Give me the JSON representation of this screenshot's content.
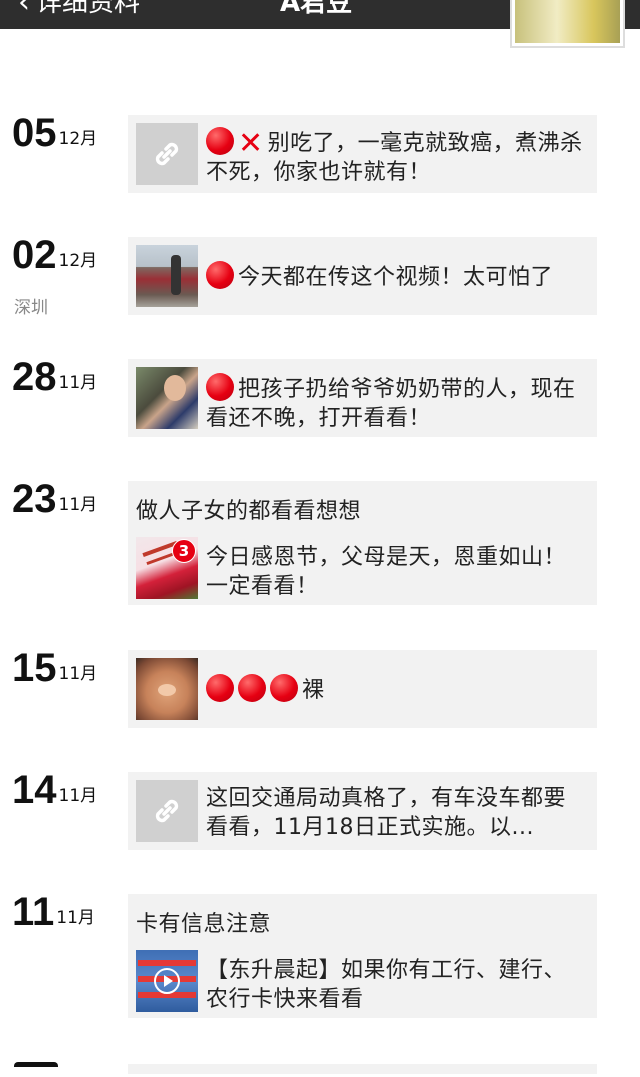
{
  "nav": {
    "back_label": "详细资料",
    "title": "A君豆"
  },
  "entries": [
    {
      "day": "05",
      "month": "12月",
      "items": [
        {
          "text": "别吃了，一毫克就致癌，煮沸杀不死，你家也许就有！",
          "thumb": "link-icon",
          "emoji": [
            "red-circle",
            "red-x"
          ]
        }
      ]
    },
    {
      "day": "02",
      "month": "12月",
      "location": "深圳",
      "items": [
        {
          "text": "今天都在传这个视频！太可怕了",
          "thumb": "photo-car",
          "emoji": [
            "red-circle"
          ]
        }
      ]
    },
    {
      "day": "28",
      "month": "11月",
      "items": [
        {
          "text": "把孩子扔给爷爷奶奶带的人，现在看还不晚，打开看看！",
          "thumb": "photo-woman",
          "emoji": [
            "red-circle"
          ]
        }
      ]
    },
    {
      "day": "23",
      "month": "11月",
      "caption": "做人子女的都看看想想",
      "items": [
        {
          "text": "今日感恩节，父母是天，恩重如山！一定看看！",
          "thumb": "photo-flowers",
          "badge": "3"
        }
      ]
    },
    {
      "day": "15",
      "month": "11月",
      "items": [
        {
          "text": "裸",
          "thumb": "photo-hand",
          "emoji": [
            "red-circle",
            "red-circle",
            "red-circle"
          ]
        }
      ]
    },
    {
      "day": "14",
      "month": "11月",
      "items": [
        {
          "text": "这回交通局动真格了，有车没车都要看看，11月18日正式实施。以...",
          "thumb": "link-icon"
        }
      ]
    },
    {
      "day": "11",
      "month": "11月",
      "caption": "卡有信息注意",
      "items": [
        {
          "text": "【东升晨起】如果你有工行、建行、农行卡快来看看",
          "thumb": "video-bank"
        }
      ]
    }
  ]
}
